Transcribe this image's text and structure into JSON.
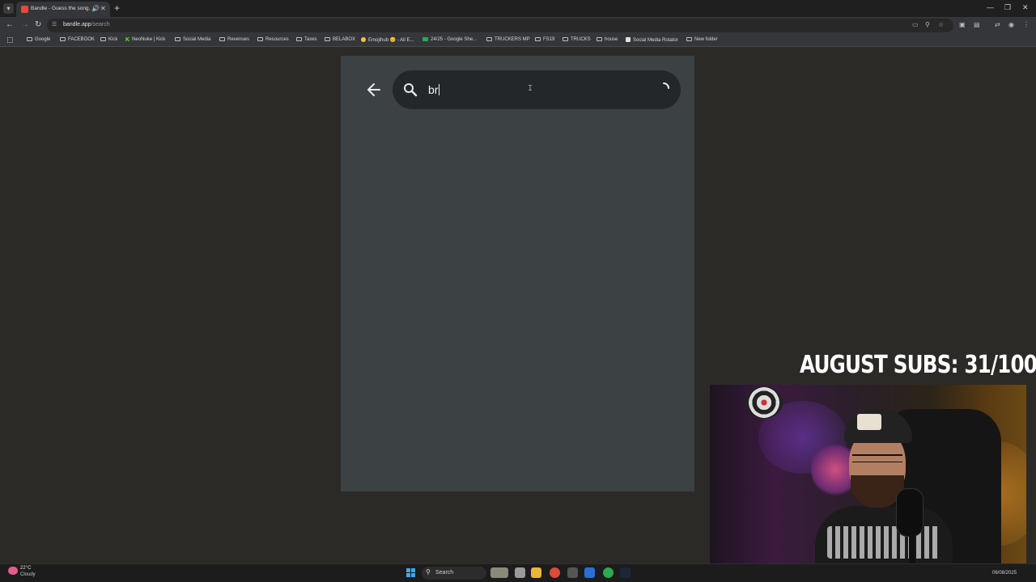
{
  "browser": {
    "tab": {
      "title": "Bandle - Guess the song, o..."
    },
    "url": {
      "host": "bandle.app",
      "path": "/search"
    },
    "bookmarks": [
      "Google",
      "FACEBOOK",
      "Kick",
      "NeoNuke | Kick",
      "Social Media",
      "Revenues",
      "Resources",
      "Taxes",
      "BELABOX",
      "Emojihub 😊 - All E...",
      "24/25 - Google She...",
      "TRUCKERS MP",
      "FS19",
      "TRUCKS",
      "house",
      "Social Media Rotator",
      "New folder"
    ]
  },
  "search": {
    "value": "br"
  },
  "overlay": {
    "subs_text": "AUGUST SUBS: 31/100"
  },
  "taskbar": {
    "weather_temp": "22°C",
    "weather_desc": "Cloudy",
    "search_label": "Search",
    "date": "06/08/2025"
  },
  "icons": {
    "back": "arrow-left-icon",
    "search": "search-icon",
    "loading": "spinner-icon"
  },
  "colors": {
    "page_bg": "#2b2a27",
    "panel_bg": "#3c4144",
    "searchbar_bg": "#23272a",
    "subs_text": "#ffffff"
  }
}
